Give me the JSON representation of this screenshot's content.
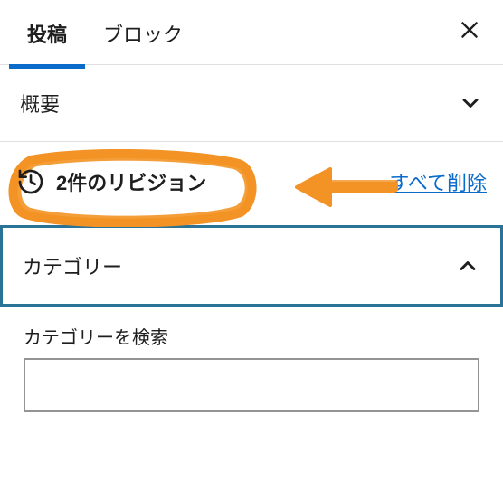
{
  "tabs": {
    "post": "投稿",
    "block": "ブロック"
  },
  "panels": {
    "summary": {
      "title": "概要"
    },
    "categories": {
      "title": "カテゴリー"
    }
  },
  "revisions": {
    "label": "2件のリビジョン",
    "delete_all": "すべて削除"
  },
  "search": {
    "label": "カテゴリーを検索",
    "value": ""
  },
  "annotation": {
    "color": "#f39325"
  }
}
